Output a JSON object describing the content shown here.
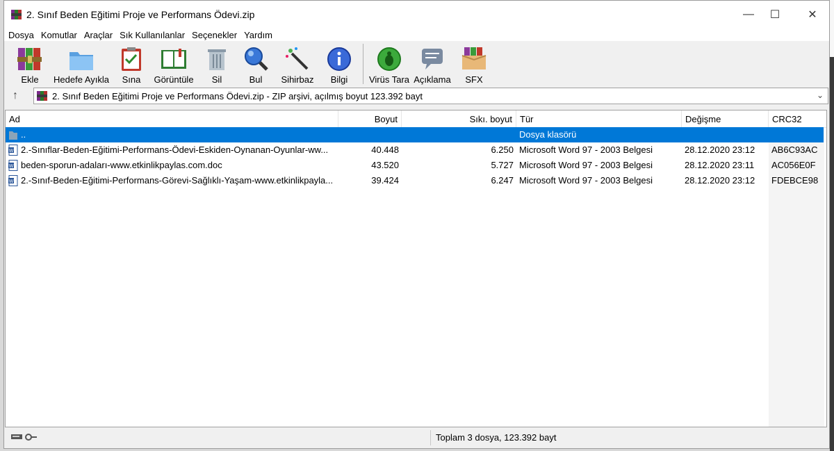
{
  "window": {
    "title": "2. Sınıf Beden Eğitimi Proje ve Performans Ödevi.zip",
    "minimize_glyph": "—",
    "maximize_glyph": "☐",
    "close_glyph": "✕"
  },
  "menu": [
    "Dosya",
    "Komutlar",
    "Araçlar",
    "Sık Kullanılanlar",
    "Seçenekler",
    "Yardım"
  ],
  "toolbar": [
    {
      "label": "Ekle",
      "icon": "books-archive-icon"
    },
    {
      "label": "Hedefe Ayıkla",
      "icon": "folder-extract-icon"
    },
    {
      "label": "Sına",
      "icon": "clipboard-check-icon"
    },
    {
      "label": "Görüntüle",
      "icon": "open-book-icon"
    },
    {
      "label": "Sil",
      "icon": "trash-can-icon"
    },
    {
      "label": "Bul",
      "icon": "magnifier-icon"
    },
    {
      "label": "Sihirbaz",
      "icon": "magic-wand-icon"
    },
    {
      "label": "Bilgi",
      "icon": "info-icon"
    },
    {
      "label": "Virüs Tara",
      "icon": "virus-bug-icon"
    },
    {
      "label": "Açıklama",
      "icon": "comment-bubble-icon"
    },
    {
      "label": "SFX",
      "icon": "sfx-box-icon"
    }
  ],
  "address": {
    "up_glyph": "↑",
    "text": "2. Sınıf Beden Eğitimi Proje ve Performans Ödevi.zip - ZIP arşivi, açılmış boyut 123.392 bayt",
    "dropdown_glyph": "⌄"
  },
  "columns": {
    "name": "Ad",
    "size": "Boyut",
    "packed": "Sıkı. boyut",
    "type": "Tür",
    "modified": "Değişme",
    "crc": "CRC32"
  },
  "rows": [
    {
      "name": "..",
      "size": "",
      "packed": "",
      "type": "Dosya klasörü",
      "modified": "",
      "crc": "",
      "selected": true,
      "icon": "folder-up-icon"
    },
    {
      "name": "2.-Sınıflar-Beden-Eğitimi-Performans-Ödevi-Eskiden-Oynanan-Oyunlar-ww...",
      "size": "40.448",
      "packed": "6.250",
      "type": "Microsoft Word 97 - 2003 Belgesi",
      "modified": "28.12.2020 23:12",
      "crc": "AB6C93AC",
      "icon": "word-doc-icon"
    },
    {
      "name": "beden-sporun-adaları-www.etkinlikpaylas.com.doc",
      "size": "43.520",
      "packed": "5.727",
      "type": "Microsoft Word 97 - 2003 Belgesi",
      "modified": "28.12.2020 23:11",
      "crc": "AC056E0F",
      "icon": "word-doc-icon"
    },
    {
      "name": "2.-Sınıf-Beden-Eğitimi-Performans-Görevi-Sağlıklı-Yaşam-www.etkinlikpayla...",
      "size": "39.424",
      "packed": "6.247",
      "type": "Microsoft Word 97 - 2003 Belgesi",
      "modified": "28.12.2020 23:12",
      "crc": "FDEBCE98",
      "icon": "word-doc-icon"
    }
  ],
  "status": {
    "message": "Toplam 3 dosya, 123.392 bayt"
  },
  "colors": {
    "selection": "#0078d7",
    "window_bg": "#f0f0f0"
  }
}
